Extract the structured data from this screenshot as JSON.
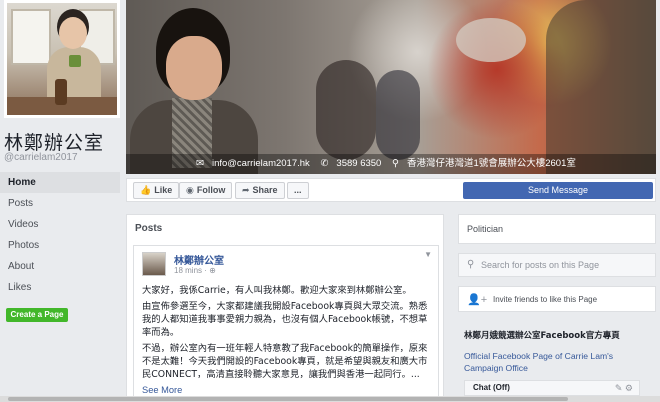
{
  "profile": {
    "name": "林鄭辦公室",
    "handle": "@carrielam2017"
  },
  "cover": {
    "email": "info@carrielam2017.hk",
    "phone": "3589 6350",
    "address": "香港灣仔港灣道1號會展辦公大樓2601室"
  },
  "nav": {
    "items": [
      "Home",
      "Posts",
      "Videos",
      "Photos",
      "About",
      "Likes"
    ],
    "active": "Home",
    "create_label": "Create a Page"
  },
  "actions": {
    "like": "Like",
    "follow": "Follow",
    "share": "Share",
    "more": "...",
    "send_message": "Send Message"
  },
  "posts_section": {
    "title": "Posts",
    "post": {
      "author": "林鄭辦公室",
      "time": "18 mins",
      "paragraphs": [
        "大家好，我係Carrie，有人叫我林鄭。歡迎大家來到林鄭辦公室。",
        "由宣佈參選至今，大家都建議我開設Facebook專頁與大眾交流。熟悉我的人都知道我事事愛親力親為，也沒有個人Facebook帳號，不想草率而為。",
        "不過，辦公室內有一班年輕人特意教了我Facebook的簡單操作，原來不是太難！今天我們開設的Facebook專頁，就是希望與親友和廣大市民CONNECT，高清直接聆聽大家意見，讓我們與香港一起同行。..."
      ],
      "see_more": "See More"
    }
  },
  "sidebar": {
    "category": "Politician",
    "search_placeholder": "Search for posts on this Page",
    "invite": "Invite friends to like this Page",
    "promo_title": "林鄭月娥競選辦公室Facebook官方專頁",
    "promo_sub": "Official Facebook Page of Carrie Lam's Campaign Office",
    "chat": "Chat (Off)"
  }
}
